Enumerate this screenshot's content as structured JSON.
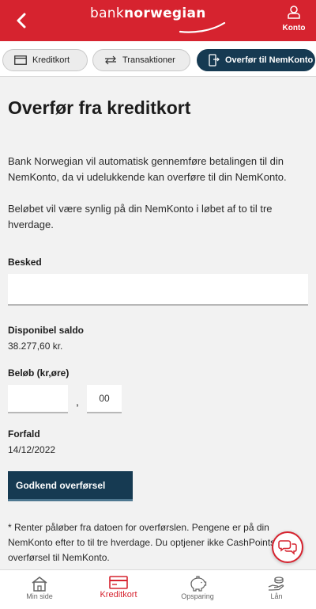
{
  "header": {
    "logo_part1": "bank",
    "logo_part2": "norwegian",
    "account_label": "Konto",
    "brand_color": "#d6232f",
    "icons": {
      "back": "chevron-left-icon",
      "account": "user-icon"
    }
  },
  "tabs": [
    {
      "label": "Kreditkort",
      "icon": "card-icon",
      "active": false
    },
    {
      "label": "Transaktioner",
      "icon": "arrows-icon",
      "active": false
    },
    {
      "label": "Overfør til NemKonto",
      "icon": "phone-transfer-icon",
      "active": true
    }
  ],
  "page": {
    "title": "Overfør fra kreditkort",
    "paragraph1": "Bank Norwegian vil automatisk gennemføre betalingen til din NemKonto, da vi udelukkende kan overføre til din NemKonto.",
    "paragraph2": "Beløbet vil være synlig på din NemKonto i løbet af to til tre hverdage."
  },
  "form": {
    "message_label": "Besked",
    "message_value": "",
    "balance_label": "Disponibel saldo",
    "balance_value": "38.277,60 kr.",
    "amount_label": "Beløb (kr,øre)",
    "amount_kr_value": "",
    "amount_separator": ",",
    "amount_ore_value": "00",
    "due_label": "Forfald",
    "due_value": "14/12/2022",
    "approve_button": "Godkend overførsel"
  },
  "footnote": "* Renter påløber fra datoen for overførslen. Pengene er på din NemKonto efter to til tre hverdage. Du optjener ikke CashPoints ved overførsel til NemKonto.",
  "bottom_nav": [
    {
      "label": "Min side",
      "icon": "house-icon",
      "active": false
    },
    {
      "label": "Kreditkort",
      "icon": "card-icon",
      "active": true
    },
    {
      "label": "Opsparing",
      "icon": "piggy-bank-icon",
      "active": false
    },
    {
      "label": "Lån",
      "icon": "hand-coin-icon",
      "active": false
    }
  ],
  "colors": {
    "primary_dark": "#163a52",
    "brand_red": "#d6232f"
  }
}
